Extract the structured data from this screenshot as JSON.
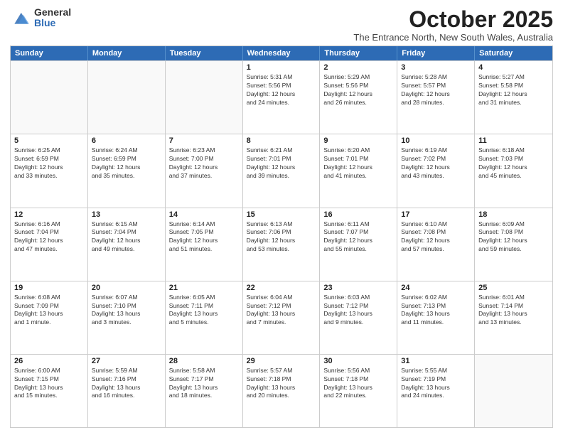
{
  "logo": {
    "general": "General",
    "blue": "Blue"
  },
  "header": {
    "month": "October 2025",
    "location": "The Entrance North, New South Wales, Australia"
  },
  "weekdays": [
    "Sunday",
    "Monday",
    "Tuesday",
    "Wednesday",
    "Thursday",
    "Friday",
    "Saturday"
  ],
  "rows": [
    [
      {
        "day": "",
        "info": ""
      },
      {
        "day": "",
        "info": ""
      },
      {
        "day": "",
        "info": ""
      },
      {
        "day": "1",
        "info": "Sunrise: 5:31 AM\nSunset: 5:56 PM\nDaylight: 12 hours\nand 24 minutes."
      },
      {
        "day": "2",
        "info": "Sunrise: 5:29 AM\nSunset: 5:56 PM\nDaylight: 12 hours\nand 26 minutes."
      },
      {
        "day": "3",
        "info": "Sunrise: 5:28 AM\nSunset: 5:57 PM\nDaylight: 12 hours\nand 28 minutes."
      },
      {
        "day": "4",
        "info": "Sunrise: 5:27 AM\nSunset: 5:58 PM\nDaylight: 12 hours\nand 31 minutes."
      }
    ],
    [
      {
        "day": "5",
        "info": "Sunrise: 6:25 AM\nSunset: 6:59 PM\nDaylight: 12 hours\nand 33 minutes."
      },
      {
        "day": "6",
        "info": "Sunrise: 6:24 AM\nSunset: 6:59 PM\nDaylight: 12 hours\nand 35 minutes."
      },
      {
        "day": "7",
        "info": "Sunrise: 6:23 AM\nSunset: 7:00 PM\nDaylight: 12 hours\nand 37 minutes."
      },
      {
        "day": "8",
        "info": "Sunrise: 6:21 AM\nSunset: 7:01 PM\nDaylight: 12 hours\nand 39 minutes."
      },
      {
        "day": "9",
        "info": "Sunrise: 6:20 AM\nSunset: 7:01 PM\nDaylight: 12 hours\nand 41 minutes."
      },
      {
        "day": "10",
        "info": "Sunrise: 6:19 AM\nSunset: 7:02 PM\nDaylight: 12 hours\nand 43 minutes."
      },
      {
        "day": "11",
        "info": "Sunrise: 6:18 AM\nSunset: 7:03 PM\nDaylight: 12 hours\nand 45 minutes."
      }
    ],
    [
      {
        "day": "12",
        "info": "Sunrise: 6:16 AM\nSunset: 7:04 PM\nDaylight: 12 hours\nand 47 minutes."
      },
      {
        "day": "13",
        "info": "Sunrise: 6:15 AM\nSunset: 7:04 PM\nDaylight: 12 hours\nand 49 minutes."
      },
      {
        "day": "14",
        "info": "Sunrise: 6:14 AM\nSunset: 7:05 PM\nDaylight: 12 hours\nand 51 minutes."
      },
      {
        "day": "15",
        "info": "Sunrise: 6:13 AM\nSunset: 7:06 PM\nDaylight: 12 hours\nand 53 minutes."
      },
      {
        "day": "16",
        "info": "Sunrise: 6:11 AM\nSunset: 7:07 PM\nDaylight: 12 hours\nand 55 minutes."
      },
      {
        "day": "17",
        "info": "Sunrise: 6:10 AM\nSunset: 7:08 PM\nDaylight: 12 hours\nand 57 minutes."
      },
      {
        "day": "18",
        "info": "Sunrise: 6:09 AM\nSunset: 7:08 PM\nDaylight: 12 hours\nand 59 minutes."
      }
    ],
    [
      {
        "day": "19",
        "info": "Sunrise: 6:08 AM\nSunset: 7:09 PM\nDaylight: 13 hours\nand 1 minute."
      },
      {
        "day": "20",
        "info": "Sunrise: 6:07 AM\nSunset: 7:10 PM\nDaylight: 13 hours\nand 3 minutes."
      },
      {
        "day": "21",
        "info": "Sunrise: 6:05 AM\nSunset: 7:11 PM\nDaylight: 13 hours\nand 5 minutes."
      },
      {
        "day": "22",
        "info": "Sunrise: 6:04 AM\nSunset: 7:12 PM\nDaylight: 13 hours\nand 7 minutes."
      },
      {
        "day": "23",
        "info": "Sunrise: 6:03 AM\nSunset: 7:12 PM\nDaylight: 13 hours\nand 9 minutes."
      },
      {
        "day": "24",
        "info": "Sunrise: 6:02 AM\nSunset: 7:13 PM\nDaylight: 13 hours\nand 11 minutes."
      },
      {
        "day": "25",
        "info": "Sunrise: 6:01 AM\nSunset: 7:14 PM\nDaylight: 13 hours\nand 13 minutes."
      }
    ],
    [
      {
        "day": "26",
        "info": "Sunrise: 6:00 AM\nSunset: 7:15 PM\nDaylight: 13 hours\nand 15 minutes."
      },
      {
        "day": "27",
        "info": "Sunrise: 5:59 AM\nSunset: 7:16 PM\nDaylight: 13 hours\nand 16 minutes."
      },
      {
        "day": "28",
        "info": "Sunrise: 5:58 AM\nSunset: 7:17 PM\nDaylight: 13 hours\nand 18 minutes."
      },
      {
        "day": "29",
        "info": "Sunrise: 5:57 AM\nSunset: 7:18 PM\nDaylight: 13 hours\nand 20 minutes."
      },
      {
        "day": "30",
        "info": "Sunrise: 5:56 AM\nSunset: 7:18 PM\nDaylight: 13 hours\nand 22 minutes."
      },
      {
        "day": "31",
        "info": "Sunrise: 5:55 AM\nSunset: 7:19 PM\nDaylight: 13 hours\nand 24 minutes."
      },
      {
        "day": "",
        "info": ""
      }
    ]
  ]
}
